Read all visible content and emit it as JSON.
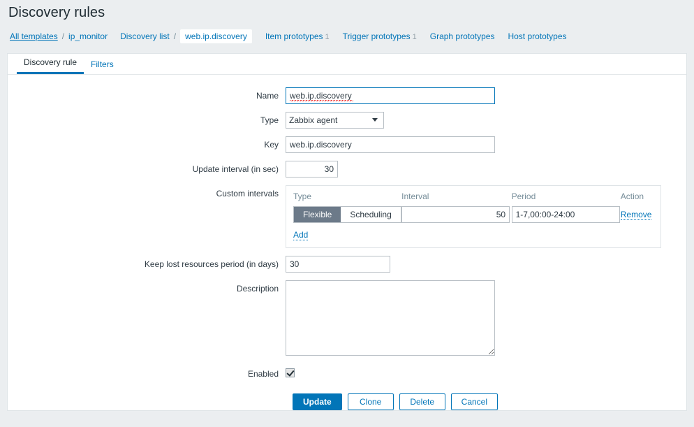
{
  "header": {
    "title": "Discovery rules"
  },
  "breadcrumb": {
    "all_templates": "All templates",
    "sep": "/",
    "template": "ip_monitor",
    "discovery_list": "Discovery list",
    "current": "web.ip.discovery"
  },
  "nav": {
    "items": [
      {
        "label": "Item prototypes",
        "count": "1"
      },
      {
        "label": "Trigger prototypes",
        "count": "1"
      },
      {
        "label": "Graph prototypes",
        "count": ""
      },
      {
        "label": "Host prototypes",
        "count": ""
      }
    ]
  },
  "tabs": [
    {
      "label": "Discovery rule",
      "active": true
    },
    {
      "label": "Filters",
      "active": false
    }
  ],
  "form": {
    "name": {
      "label": "Name",
      "value": "web.ip.discovery",
      "placeholder": ""
    },
    "type": {
      "label": "Type",
      "value": "Zabbix agent",
      "options": [
        "Zabbix agent"
      ]
    },
    "key": {
      "label": "Key",
      "value": "web.ip.discovery",
      "placeholder": ""
    },
    "update_interval": {
      "label": "Update interval (in sec)",
      "value": "30"
    },
    "custom_intervals": {
      "label": "Custom intervals",
      "columns": [
        "Type",
        "Interval",
        "Period",
        "Action"
      ],
      "rows": [
        {
          "type_flexible": "Flexible",
          "type_scheduling": "Scheduling",
          "selected_type": "Flexible",
          "interval": "50",
          "period": "1-7,00:00-24:00",
          "action": "Remove"
        }
      ],
      "add_label": "Add"
    },
    "keep_lost": {
      "label": "Keep lost resources period (in days)",
      "value": "30"
    },
    "description": {
      "label": "Description",
      "value": "",
      "placeholder": ""
    },
    "enabled": {
      "label": "Enabled",
      "checked": true
    }
  },
  "buttons": {
    "update": "Update",
    "clone": "Clone",
    "delete": "Delete",
    "cancel": "Cancel"
  },
  "colors": {
    "accent": "#0275b8",
    "toggle_selected": "#6c7a89",
    "page_bg": "#ebeef0",
    "label_muted": "#768d99"
  }
}
